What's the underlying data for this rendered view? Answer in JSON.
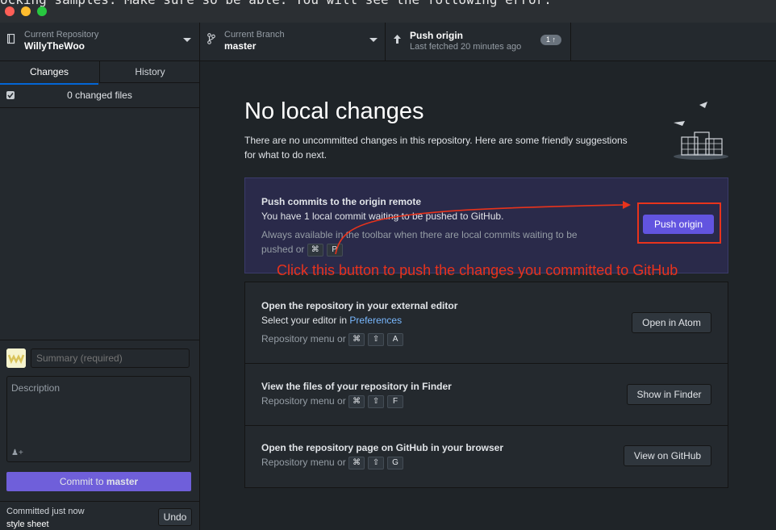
{
  "background_code_text": "ocking samples. Make sure so be able. You will see the following error:",
  "toolbar": {
    "repo": {
      "title": "Current Repository",
      "value": "WillyTheWoo"
    },
    "branch": {
      "title": "Current Branch",
      "value": "master"
    },
    "push": {
      "title": "Push origin",
      "subtitle": "Last fetched 20 minutes ago",
      "badge": "1 ↑"
    }
  },
  "sidebar": {
    "tabs": [
      "Changes",
      "History"
    ],
    "changed_files": "0 changed files",
    "summary_placeholder": "Summary (required)",
    "description_placeholder": "Description",
    "commit_button": {
      "prefix": "Commit to ",
      "branch": "master"
    },
    "last_commit": {
      "label": "Committed just now",
      "message": "style sheet",
      "undo": "Undo"
    }
  },
  "main": {
    "heading": "No local changes",
    "intro_line1": "There are no uncommitted changes in this repository. Here are some friendly suggestions",
    "intro_line2": "for what to do next.",
    "push_card": {
      "title": "Push commits to the origin remote",
      "text": "You have 1 local commit waiting to be pushed to GitHub.",
      "hint_line1": "Always available in the toolbar when there are local commits waiting to be",
      "hint_prefix": "pushed or",
      "keys": [
        "⌘",
        "P"
      ],
      "button": "Push origin"
    },
    "annotation": "Click this button to push the changes you committed to GitHub",
    "editor_card": {
      "title": "Open the repository in your external editor",
      "text_prefix": "Select your editor in ",
      "link": "Preferences",
      "hint_prefix": "Repository menu or",
      "keys": [
        "⌘",
        "⇧",
        "A"
      ],
      "button": "Open in Atom"
    },
    "finder_card": {
      "title": "View the files of your repository in Finder",
      "hint_prefix": "Repository menu or",
      "keys": [
        "⌘",
        "⇧",
        "F"
      ],
      "button": "Show in Finder"
    },
    "github_card": {
      "title": "Open the repository page on GitHub in your browser",
      "hint_prefix": "Repository menu or",
      "keys": [
        "⌘",
        "⇧",
        "G"
      ],
      "button": "View on GitHub"
    }
  },
  "colors": {
    "accent": "#6f5fda",
    "push_button": "#6254e0",
    "annotation_red": "#e8331c",
    "tab_underline": "#0366d6",
    "link": "#79b8ff"
  }
}
